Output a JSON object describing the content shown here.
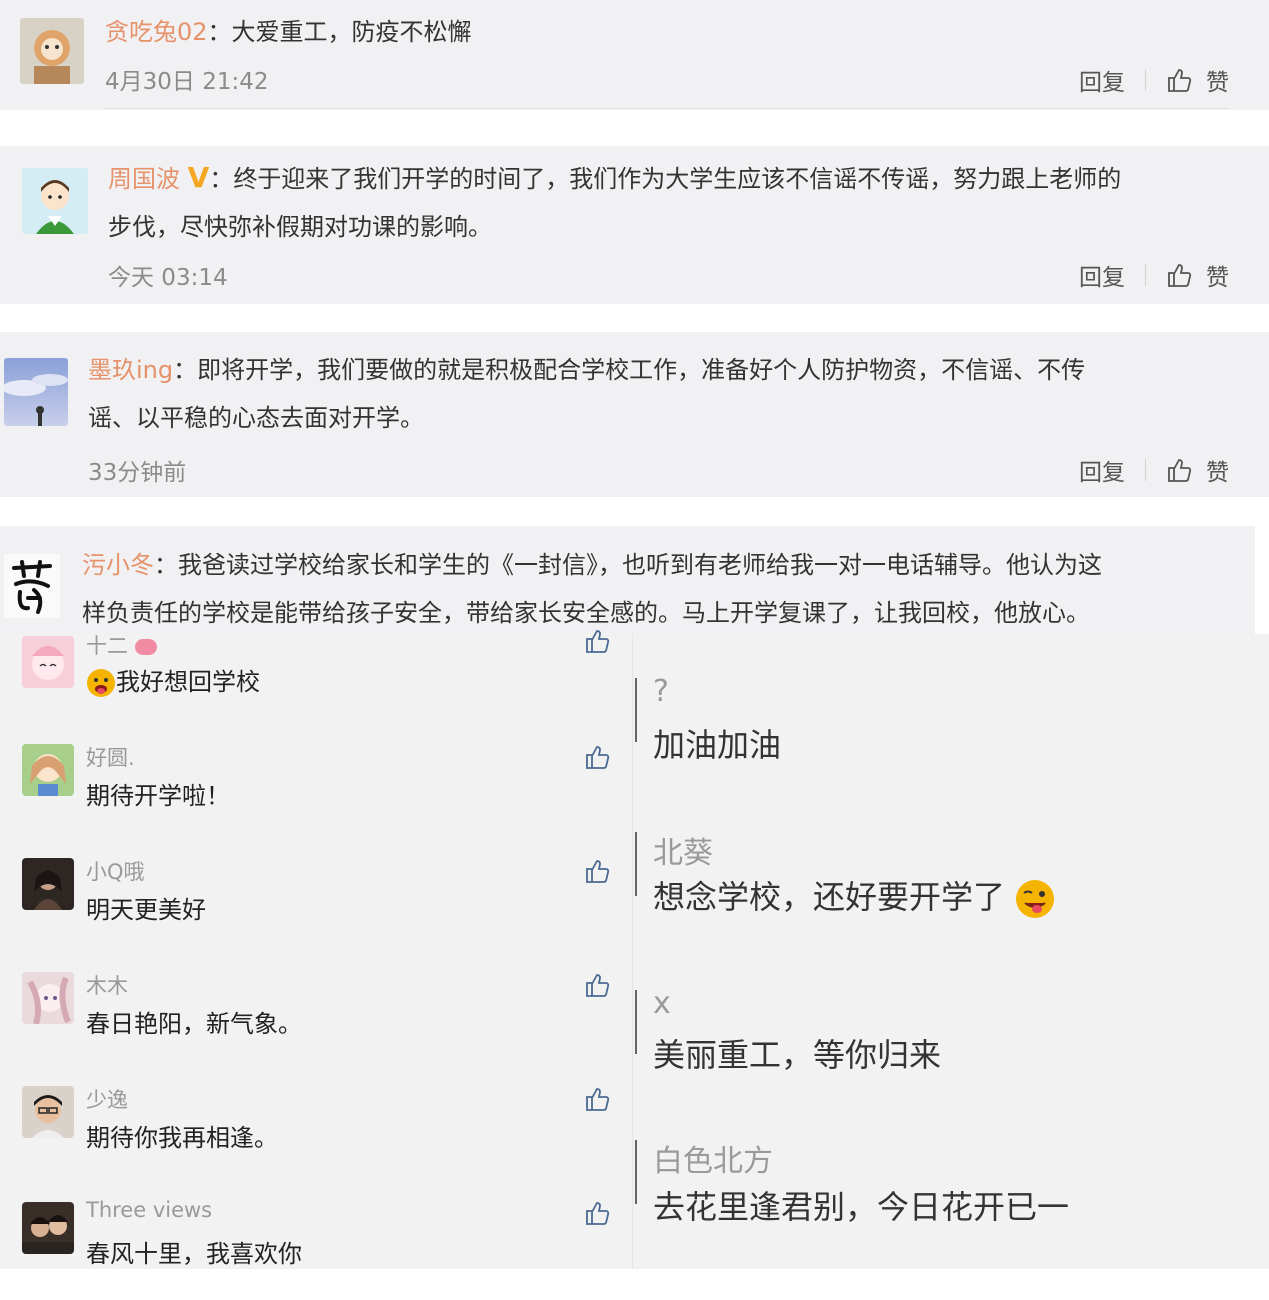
{
  "top_comments": [
    {
      "user": "贪吃兔02",
      "sep": "：",
      "text": "大爱重工，防疫不松懈",
      "time": "4月30日 21:42"
    },
    {
      "user": "周国波",
      "badge": "V",
      "sep": "：",
      "text": "终于迎来了我们开学的时间了，我们作为大学生应该不信谣不传谣，努力跟上老师的",
      "text2": "步伐，尽快弥补假期对功课的影响。",
      "time": "今天 03:14"
    },
    {
      "user": "墨玖ing",
      "sep": "：",
      "text": "即将开学，我们要做的就是积极配合学校工作，准备好个人防护物资，不信谣、不传",
      "text2": "谣、以平稳的心态去面对开学。",
      "time": "33分钟前"
    },
    {
      "user": "污小冬",
      "sep": "：",
      "text": "我爸读过学校给家长和学生的《一封信》，也听到有老师给我一对一电话辅导。他认为这",
      "text2": "样负责任的学校是能带给孩子安全，带给家长安全感的。马上开学复课了，让我回校，他放心。"
    }
  ],
  "actions": {
    "reply": "回复",
    "like": "赞"
  },
  "left_list": [
    {
      "name": "十二",
      "comment": "我好想回学校",
      "avatar_color": "#f6c6d4"
    },
    {
      "name": "好圆.",
      "comment": "期待开学啦！",
      "avatar_color": "#a8cf8a"
    },
    {
      "name": "小Q哦",
      "comment": "明天更美好",
      "avatar_color": "#3a2f2a"
    },
    {
      "name": "木木",
      "comment": "春日艳阳，新气象。",
      "avatar_color": "#e9d7db"
    },
    {
      "name": "少逸",
      "comment": "期待你我再相逢。",
      "avatar_color": "#c49a7c"
    },
    {
      "name": "Three views",
      "comment": "春风十里，我喜欢你",
      "avatar_color": "#4a3b33"
    }
  ],
  "right_list": [
    {
      "name": "?",
      "comment": "加油加油"
    },
    {
      "name": "北葵",
      "comment": "想念学校，还好要开学了"
    },
    {
      "name": "x",
      "comment": "美丽重工，等你归来"
    },
    {
      "name": "白色北方",
      "comment": "去花里逢君别，今日花开已一"
    }
  ],
  "colors": {
    "username": "#e6926a",
    "badge": "#f5a623",
    "card_bg": "#f1f1f3"
  }
}
